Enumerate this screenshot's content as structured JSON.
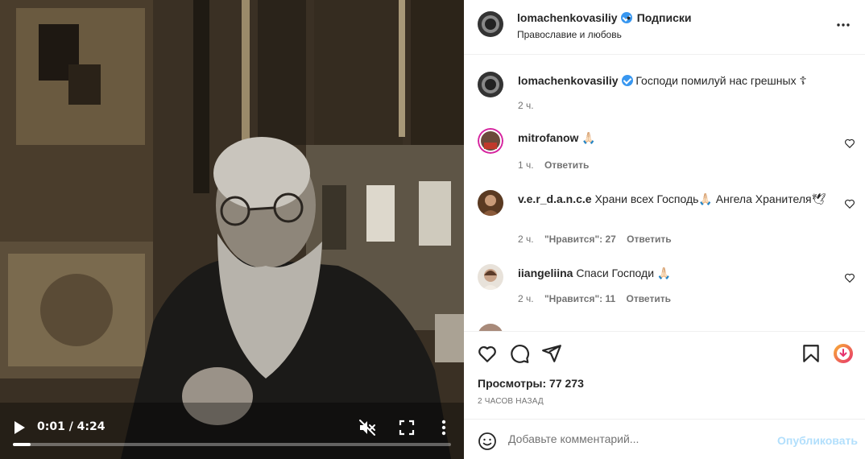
{
  "video": {
    "time": "0:01 / 4:24",
    "progress": 0.04,
    "icons": [
      "play-icon",
      "mute-icon",
      "fullscreen-icon",
      "more-vertical-icon"
    ]
  },
  "header": {
    "username": "lomachenkovasiliy",
    "separator": "•",
    "follow_label": "Подписки",
    "subtitle": "Православие и любовь"
  },
  "caption": {
    "username": "lomachenkovasiliy",
    "text": "Господи помилуй нас грешных ☦",
    "time": "2 ч."
  },
  "comments": [
    {
      "username": "mitrofanow",
      "text": "🙏🏻",
      "time": "1 ч.",
      "likes": "",
      "reply": "Ответить"
    },
    {
      "username": "v.e.r_d.a.n.c.e",
      "text": "Храни всех Господь🙏🏻 Ангела Хранителя🕊",
      "time": "2 ч.",
      "likes": "\"Нравится\": 27",
      "reply": "Ответить"
    },
    {
      "username": "iiangeliina",
      "text": "Спаси Господи 🙏🏻",
      "time": "2 ч.",
      "likes": "\"Нравится\": 11",
      "reply": "Ответить"
    }
  ],
  "stats": {
    "views": "Просмотры: 77 273",
    "posted": "2 ЧАСОВ НАЗАД"
  },
  "composer": {
    "placeholder": "Добавьте комментарий...",
    "publish": "Опубликовать"
  },
  "colors": {
    "verified": "#3897f0",
    "publish_disabled": "#b2dffc",
    "meta": "#737373"
  }
}
